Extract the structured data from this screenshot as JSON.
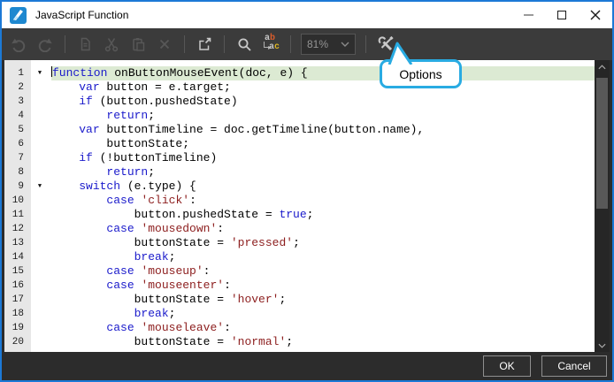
{
  "window": {
    "title": "JavaScript Function"
  },
  "titlebar": {
    "controls": [
      "minimize",
      "maximize",
      "close"
    ]
  },
  "toolbar": {
    "zoom_value": "81%",
    "replace_icon_top": "ab",
    "replace_icon_bottom": "ac",
    "icons": [
      "undo-icon",
      "redo-icon",
      "copy-icon",
      "cut-icon",
      "paste-icon",
      "delete-icon",
      "external-editor-icon",
      "search-icon",
      "replace-icon",
      "chevron-down-icon",
      "tools-icon"
    ]
  },
  "callout": {
    "label": "Options"
  },
  "editor": {
    "fold_glyph": "▼",
    "current_line": 1,
    "lines": [
      {
        "n": 1,
        "fold": true,
        "current": true,
        "cursor": true,
        "tokens": [
          [
            "kw",
            "function"
          ],
          [
            "pl",
            " onButtonMouseEvent(doc, e) {"
          ]
        ]
      },
      {
        "n": 2,
        "tokens": [
          [
            "pl",
            "    "
          ],
          [
            "kw",
            "var"
          ],
          [
            "pl",
            " button = e.target;"
          ]
        ]
      },
      {
        "n": 3,
        "tokens": [
          [
            "pl",
            "    "
          ],
          [
            "kw",
            "if"
          ],
          [
            "pl",
            " (button.pushedState)"
          ]
        ]
      },
      {
        "n": 4,
        "tokens": [
          [
            "pl",
            "        "
          ],
          [
            "kw",
            "return"
          ],
          [
            "pl",
            ";"
          ]
        ]
      },
      {
        "n": 5,
        "tokens": [
          [
            "pl",
            "    "
          ],
          [
            "kw",
            "var"
          ],
          [
            "pl",
            " buttonTimeline = doc.getTimeline(button.name),"
          ]
        ]
      },
      {
        "n": 6,
        "tokens": [
          [
            "pl",
            "        buttonState;"
          ]
        ]
      },
      {
        "n": 7,
        "tokens": [
          [
            "pl",
            "    "
          ],
          [
            "kw",
            "if"
          ],
          [
            "pl",
            " (!buttonTimeline)"
          ]
        ]
      },
      {
        "n": 8,
        "tokens": [
          [
            "pl",
            "        "
          ],
          [
            "kw",
            "return"
          ],
          [
            "pl",
            ";"
          ]
        ]
      },
      {
        "n": 9,
        "fold": true,
        "tokens": [
          [
            "pl",
            "    "
          ],
          [
            "kw",
            "switch"
          ],
          [
            "pl",
            " (e.type) {"
          ]
        ]
      },
      {
        "n": 10,
        "tokens": [
          [
            "pl",
            "        "
          ],
          [
            "kw",
            "case"
          ],
          [
            "pl",
            " "
          ],
          [
            "str",
            "'click'"
          ],
          [
            "pl",
            ":"
          ]
        ]
      },
      {
        "n": 11,
        "tokens": [
          [
            "pl",
            "            button.pushedState = "
          ],
          [
            "kw",
            "true"
          ],
          [
            "pl",
            ";"
          ]
        ]
      },
      {
        "n": 12,
        "tokens": [
          [
            "pl",
            "        "
          ],
          [
            "kw",
            "case"
          ],
          [
            "pl",
            " "
          ],
          [
            "str",
            "'mousedown'"
          ],
          [
            "pl",
            ":"
          ]
        ]
      },
      {
        "n": 13,
        "tokens": [
          [
            "pl",
            "            buttonState = "
          ],
          [
            "str",
            "'pressed'"
          ],
          [
            "pl",
            ";"
          ]
        ]
      },
      {
        "n": 14,
        "tokens": [
          [
            "pl",
            "            "
          ],
          [
            "kw",
            "break"
          ],
          [
            "pl",
            ";"
          ]
        ]
      },
      {
        "n": 15,
        "tokens": [
          [
            "pl",
            "        "
          ],
          [
            "kw",
            "case"
          ],
          [
            "pl",
            " "
          ],
          [
            "str",
            "'mouseup'"
          ],
          [
            "pl",
            ":"
          ]
        ]
      },
      {
        "n": 16,
        "tokens": [
          [
            "pl",
            "        "
          ],
          [
            "kw",
            "case"
          ],
          [
            "pl",
            " "
          ],
          [
            "str",
            "'mouseenter'"
          ],
          [
            "pl",
            ":"
          ]
        ]
      },
      {
        "n": 17,
        "tokens": [
          [
            "pl",
            "            buttonState = "
          ],
          [
            "str",
            "'hover'"
          ],
          [
            "pl",
            ";"
          ]
        ]
      },
      {
        "n": 18,
        "tokens": [
          [
            "pl",
            "            "
          ],
          [
            "kw",
            "break"
          ],
          [
            "pl",
            ";"
          ]
        ]
      },
      {
        "n": 19,
        "tokens": [
          [
            "pl",
            "        "
          ],
          [
            "kw",
            "case"
          ],
          [
            "pl",
            " "
          ],
          [
            "str",
            "'mouseleave'"
          ],
          [
            "pl",
            ":"
          ]
        ]
      },
      {
        "n": 20,
        "tokens": [
          [
            "pl",
            "            buttonState = "
          ],
          [
            "str",
            "'normal'"
          ],
          [
            "pl",
            ";"
          ]
        ]
      }
    ]
  },
  "footer": {
    "ok_label": "OK",
    "cancel_label": "Cancel"
  },
  "colors": {
    "window_border": "#1c79d6",
    "toolbar_bg": "#3b3b3b",
    "current_line_bg": "#dcead3",
    "keyword": "#1a1acb",
    "string": "#8c1d1d",
    "callout_border": "#29abe2"
  }
}
